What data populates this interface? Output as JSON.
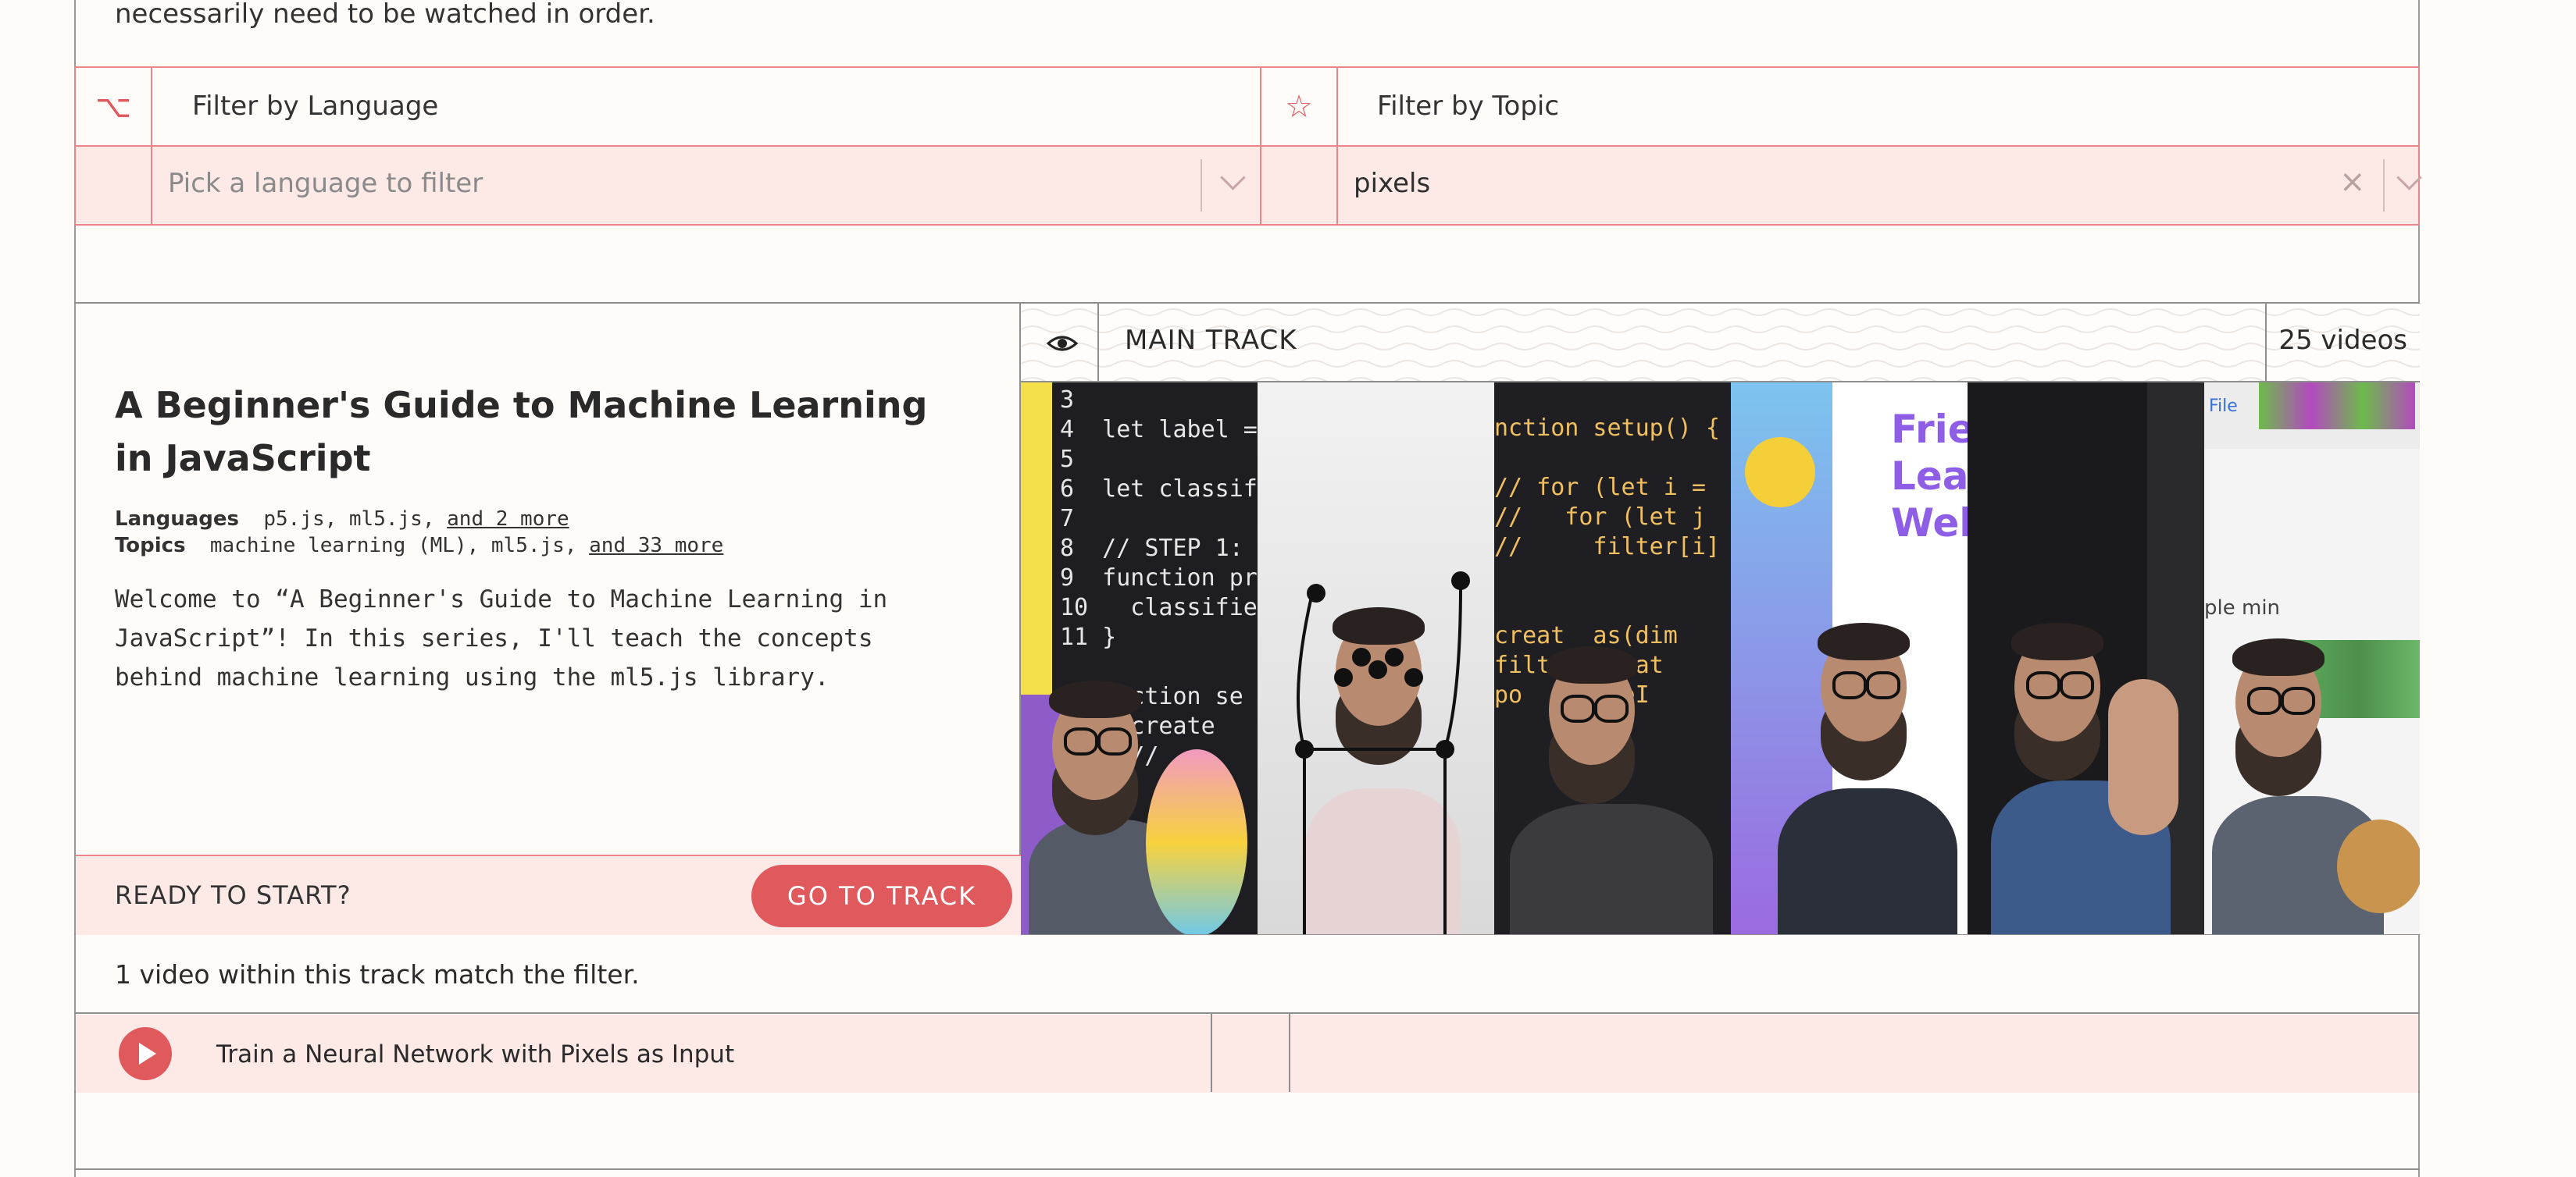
{
  "intro": {
    "text": "necessarily need to be watched in order."
  },
  "filters": {
    "language": {
      "label": "Filter by Language",
      "icon": "language-icon",
      "placeholder": "Pick a language to filter"
    },
    "topic": {
      "label": "Filter by Topic",
      "icon": "star-icon",
      "value": "pixels"
    }
  },
  "track": {
    "title": "A Beginner's Guide to Machine Learning in JavaScript",
    "languages_label": "Languages",
    "languages": "p5.js, ml5.js,",
    "languages_more": "and 2 more",
    "topics_label": "Topics",
    "topics": "machine learning (ML), ml5.js,",
    "topics_more": "and 33 more",
    "description": "Welcome to “A Beginner's Guide to Machine Learning in JavaScript”! In this series, I'll teach the concepts behind machine learning using the ml5.js library.",
    "main_track_label": "MAIN TRACK",
    "video_count": "25 videos",
    "ready_text": "READY TO START?",
    "go_button": "GO TO TRACK",
    "match_text": "1 video within this track match the filter."
  },
  "thumbnails": {
    "t1_code": "3\n4  let label =\n5\n6  let classifi\n7\n8  // STEP 1: L\n9  function pre\n10   classifier\n11 }\n\n   unction se\n     create\n     //",
    "t3_code": "nction setup() {\n\n// for (let i =\n//   for (let j\n//     filter[i]\n\n\ncreat  as(dim\nfilte  creat\npo     ateI",
    "t4_text": "Frie\nLear\nWeb",
    "t6_text": "ple min",
    "t6_file": "File"
  },
  "videos": [
    {
      "title": "Train a Neural Network with Pixels as Input"
    }
  ]
}
